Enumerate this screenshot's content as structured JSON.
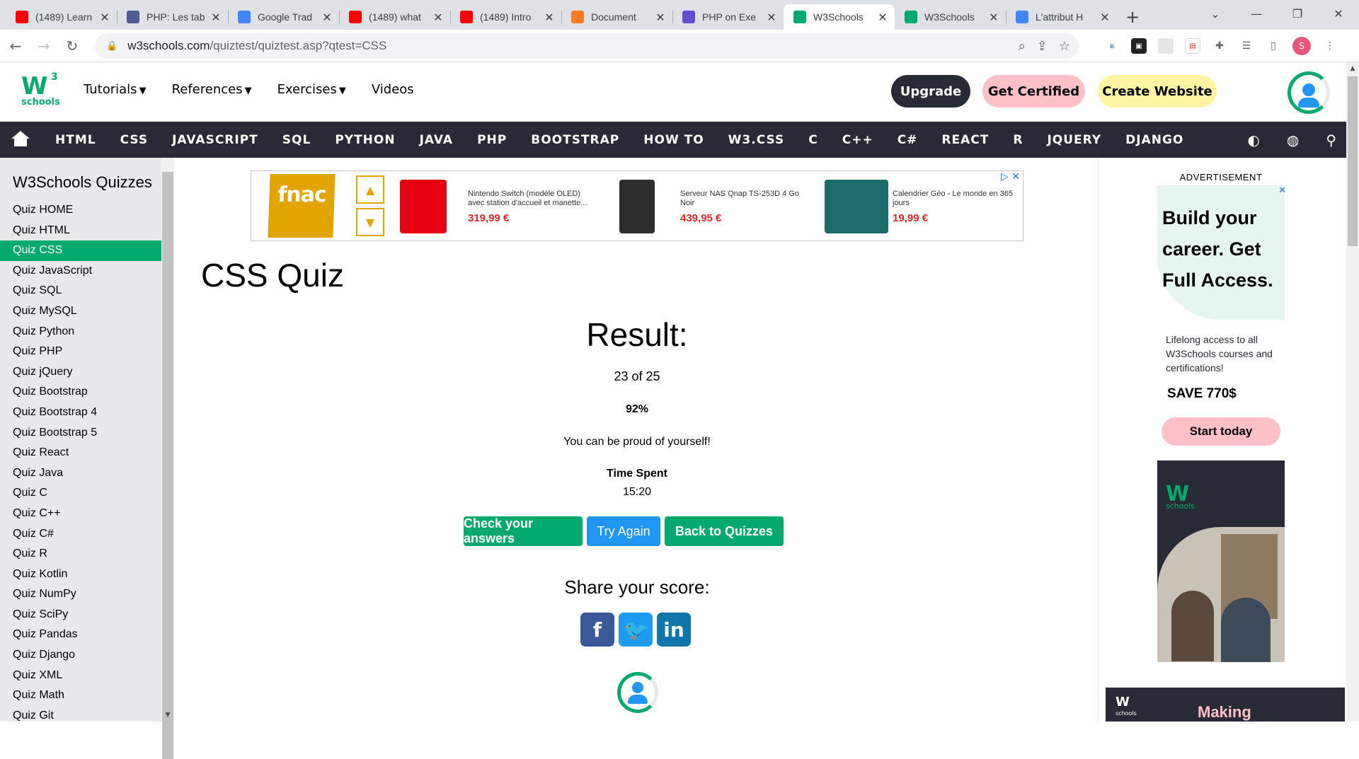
{
  "browser": {
    "tabs": [
      {
        "title": "(1489) Learn",
        "icon": "youtube-icon",
        "color": "#ff0000"
      },
      {
        "title": "PHP: Les tab",
        "icon": "php-icon",
        "color": "#4f5b93"
      },
      {
        "title": "Google Trad",
        "icon": "google-translate-icon",
        "color": "#4285f4"
      },
      {
        "title": "(1489) what",
        "icon": "youtube-icon",
        "color": "#ff0000"
      },
      {
        "title": "(1489) Intro",
        "icon": "youtube-icon",
        "color": "#ff0000"
      },
      {
        "title": "Document",
        "icon": "xampp-icon",
        "color": "#fb7a24"
      },
      {
        "title": "PHP on Exe",
        "icon": "exercism-icon",
        "color": "#604fcd"
      },
      {
        "title": "W3Schools",
        "icon": "w3schools-icon",
        "color": "#04aa6d"
      },
      {
        "title": "W3Schools",
        "icon": "w3schools-icon",
        "color": "#04aa6d"
      },
      {
        "title": "L'attribut H",
        "icon": "google-icon",
        "color": "#4285f4"
      }
    ],
    "url_host": "w3schools.com",
    "url_path": "/quiztest/quiztest.asp?qtest=CSS",
    "profile_initial": "S"
  },
  "w3": {
    "logo_w": "W",
    "logo_3": "3",
    "logo_schools": "schools",
    "top_menu": [
      "Tutorials",
      "References",
      "Exercises",
      "Videos"
    ],
    "upgrade": "Upgrade",
    "get_certified": "Get Certified",
    "create_website": "Create Website",
    "nav_items": [
      "HTML",
      "CSS",
      "JAVASCRIPT",
      "SQL",
      "PYTHON",
      "JAVA",
      "PHP",
      "BOOTSTRAP",
      "HOW TO",
      "W3.CSS",
      "C",
      "C++",
      "C#",
      "REACT",
      "R",
      "JQUERY",
      "DJANGO"
    ]
  },
  "sidebar": {
    "title": "W3Schools Quizzes",
    "active_index": 2,
    "items": [
      "Quiz HOME",
      "Quiz HTML",
      "Quiz CSS",
      "Quiz JavaScript",
      "Quiz SQL",
      "Quiz MySQL",
      "Quiz Python",
      "Quiz PHP",
      "Quiz jQuery",
      "Quiz Bootstrap",
      "Quiz Bootstrap 4",
      "Quiz Bootstrap 5",
      "Quiz React",
      "Quiz Java",
      "Quiz C",
      "Quiz C++",
      "Quiz C#",
      "Quiz R",
      "Quiz Kotlin",
      "Quiz NumPy",
      "Quiz SciPy",
      "Quiz Pandas",
      "Quiz Django",
      "Quiz XML",
      "Quiz Math",
      "Quiz Git"
    ]
  },
  "ad_top": {
    "brand": "fnac",
    "products": [
      {
        "name": "Nintendo Switch (modèle OLED) avec station d'accueil et manette...",
        "price": "319,99 €"
      },
      {
        "name": "Serveur NAS Qnap TS-253D 4 Go Noir",
        "price": "439,95 €"
      },
      {
        "name": "Calendrier Géo - Le monde en 365 jours",
        "price": "19,99 €"
      }
    ]
  },
  "main": {
    "page_title": "CSS Quiz",
    "result_heading": "Result:",
    "score": "23 of 25",
    "percent": "92%",
    "message": "You can be proud of yourself!",
    "time_label": "Time Spent",
    "time_value": "15:20",
    "buttons": {
      "check": "Check your answers",
      "try_again": "Try Again",
      "back": "Back to Quizzes"
    },
    "share_label": "Share your score:"
  },
  "ad_right": {
    "label": "ADVERTISEMENT",
    "headline_1": "Build your",
    "headline_2": "career. Get",
    "headline_3": "Full Access.",
    "sub": "Lifelong access to all W3Schools courses and certifications!",
    "save": "SAVE 770$",
    "cta": "Start today",
    "logo_w": "W",
    "logo_schools": "schools"
  },
  "ad_bottom": {
    "logo_w": "W",
    "logo_schools": "schools",
    "text": "Making"
  },
  "colors": {
    "green": "#04aa6d",
    "dark": "#282a35",
    "blue": "#2196f3",
    "pink": "#ffc0c7",
    "yellow": "#fff4a3"
  }
}
